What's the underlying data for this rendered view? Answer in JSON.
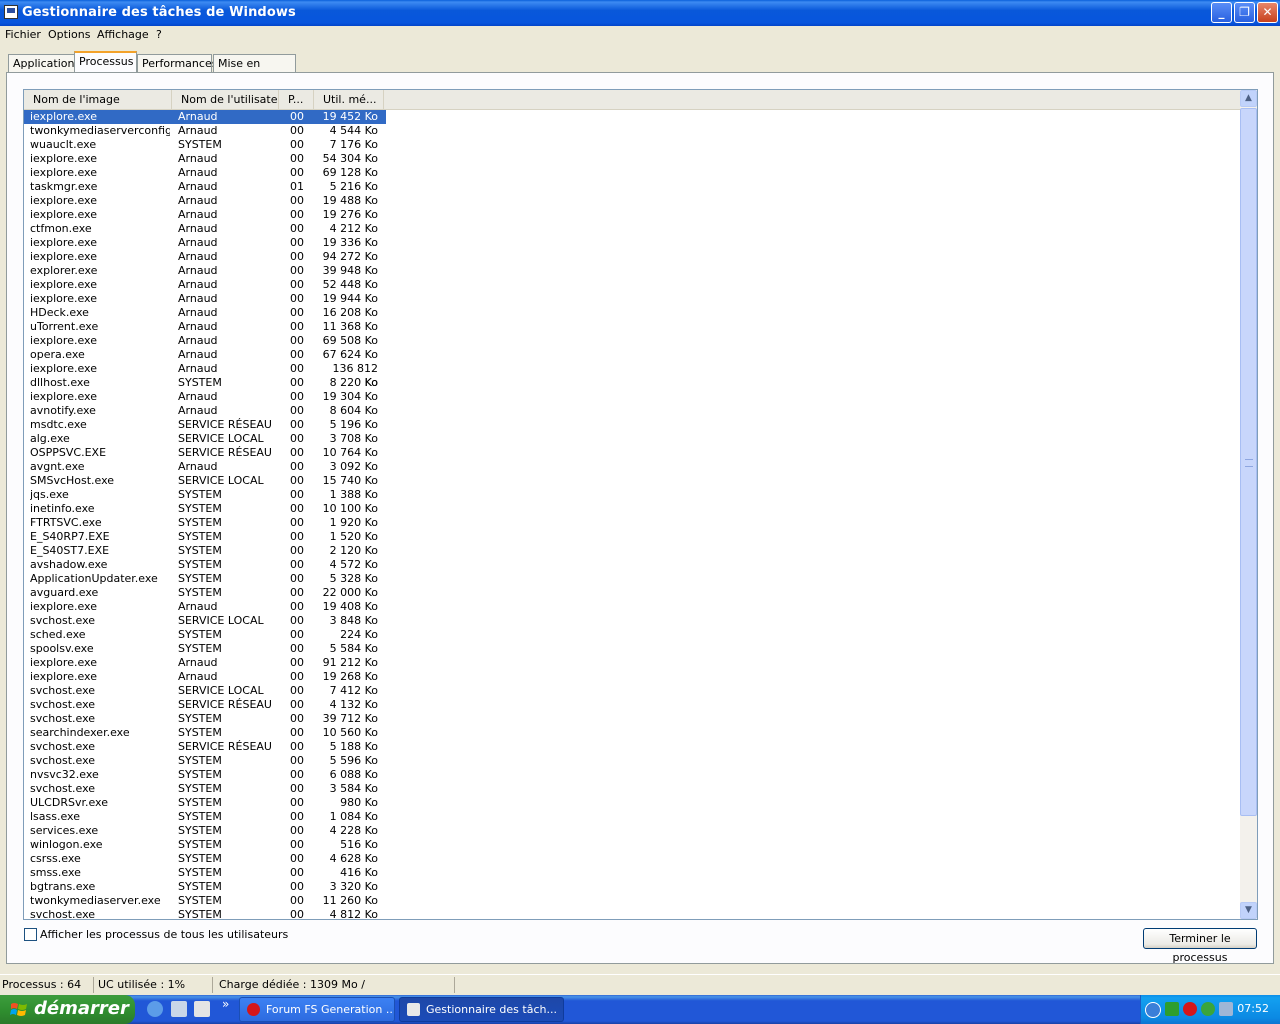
{
  "window": {
    "title": "Gestionnaire des tâches de Windows",
    "buttons": {
      "minimize": "_",
      "maximize": "❐",
      "close": "✕"
    }
  },
  "menu": [
    "Fichier",
    "Options",
    "Affichage",
    "?"
  ],
  "tabs": [
    "Applications",
    "Processus",
    "Performances",
    "Mise en réseau"
  ],
  "active_tab": "Processus",
  "columns": [
    "Nom de l'image",
    "Nom de l'utilisateur",
    "P...",
    "Util. mé..."
  ],
  "processes": [
    {
      "name": "iexplore.exe",
      "user": "Arnaud",
      "cpu": "00",
      "mem": "19 452 Ko",
      "selected": true
    },
    {
      "name": "twonkymediaserverconfig....",
      "user": "Arnaud",
      "cpu": "00",
      "mem": "4 544 Ko"
    },
    {
      "name": "wuauclt.exe",
      "user": "SYSTEM",
      "cpu": "00",
      "mem": "7 176 Ko"
    },
    {
      "name": "iexplore.exe",
      "user": "Arnaud",
      "cpu": "00",
      "mem": "54 304 Ko"
    },
    {
      "name": "iexplore.exe",
      "user": "Arnaud",
      "cpu": "00",
      "mem": "69 128 Ko"
    },
    {
      "name": "taskmgr.exe",
      "user": "Arnaud",
      "cpu": "01",
      "mem": "5 216 Ko"
    },
    {
      "name": "iexplore.exe",
      "user": "Arnaud",
      "cpu": "00",
      "mem": "19 488 Ko"
    },
    {
      "name": "iexplore.exe",
      "user": "Arnaud",
      "cpu": "00",
      "mem": "19 276 Ko"
    },
    {
      "name": "ctfmon.exe",
      "user": "Arnaud",
      "cpu": "00",
      "mem": "4 212 Ko"
    },
    {
      "name": "iexplore.exe",
      "user": "Arnaud",
      "cpu": "00",
      "mem": "19 336 Ko"
    },
    {
      "name": "iexplore.exe",
      "user": "Arnaud",
      "cpu": "00",
      "mem": "94 272 Ko"
    },
    {
      "name": "explorer.exe",
      "user": "Arnaud",
      "cpu": "00",
      "mem": "39 948 Ko"
    },
    {
      "name": "iexplore.exe",
      "user": "Arnaud",
      "cpu": "00",
      "mem": "52 448 Ko"
    },
    {
      "name": "iexplore.exe",
      "user": "Arnaud",
      "cpu": "00",
      "mem": "19 944 Ko"
    },
    {
      "name": "HDeck.exe",
      "user": "Arnaud",
      "cpu": "00",
      "mem": "16 208 Ko"
    },
    {
      "name": "uTorrent.exe",
      "user": "Arnaud",
      "cpu": "00",
      "mem": "11 368 Ko"
    },
    {
      "name": "iexplore.exe",
      "user": "Arnaud",
      "cpu": "00",
      "mem": "69 508 Ko"
    },
    {
      "name": "opera.exe",
      "user": "Arnaud",
      "cpu": "00",
      "mem": "67 624 Ko"
    },
    {
      "name": "iexplore.exe",
      "user": "Arnaud",
      "cpu": "00",
      "mem": "136 812 Ko"
    },
    {
      "name": "dllhost.exe",
      "user": "SYSTEM",
      "cpu": "00",
      "mem": "8 220 Ko"
    },
    {
      "name": "iexplore.exe",
      "user": "Arnaud",
      "cpu": "00",
      "mem": "19 304 Ko"
    },
    {
      "name": "avnotify.exe",
      "user": "Arnaud",
      "cpu": "00",
      "mem": "8 604 Ko"
    },
    {
      "name": "msdtc.exe",
      "user": "SERVICE RÉSEAU",
      "cpu": "00",
      "mem": "5 196 Ko"
    },
    {
      "name": "alg.exe",
      "user": "SERVICE LOCAL",
      "cpu": "00",
      "mem": "3 708 Ko"
    },
    {
      "name": "OSPPSVC.EXE",
      "user": "SERVICE RÉSEAU",
      "cpu": "00",
      "mem": "10 764 Ko"
    },
    {
      "name": "avgnt.exe",
      "user": "Arnaud",
      "cpu": "00",
      "mem": "3 092 Ko"
    },
    {
      "name": "SMSvcHost.exe",
      "user": "SERVICE LOCAL",
      "cpu": "00",
      "mem": "15 740 Ko"
    },
    {
      "name": "jqs.exe",
      "user": "SYSTEM",
      "cpu": "00",
      "mem": "1 388 Ko"
    },
    {
      "name": "inetinfo.exe",
      "user": "SYSTEM",
      "cpu": "00",
      "mem": "10 100 Ko"
    },
    {
      "name": "FTRTSVC.exe",
      "user": "SYSTEM",
      "cpu": "00",
      "mem": "1 920 Ko"
    },
    {
      "name": "E_S40RP7.EXE",
      "user": "SYSTEM",
      "cpu": "00",
      "mem": "1 520 Ko"
    },
    {
      "name": "E_S40ST7.EXE",
      "user": "SYSTEM",
      "cpu": "00",
      "mem": "2 120 Ko"
    },
    {
      "name": "avshadow.exe",
      "user": "SYSTEM",
      "cpu": "00",
      "mem": "4 572 Ko"
    },
    {
      "name": "ApplicationUpdater.exe",
      "user": "SYSTEM",
      "cpu": "00",
      "mem": "5 328 Ko"
    },
    {
      "name": "avguard.exe",
      "user": "SYSTEM",
      "cpu": "00",
      "mem": "22 000 Ko"
    },
    {
      "name": "iexplore.exe",
      "user": "Arnaud",
      "cpu": "00",
      "mem": "19 408 Ko"
    },
    {
      "name": "svchost.exe",
      "user": "SERVICE LOCAL",
      "cpu": "00",
      "mem": "3 848 Ko"
    },
    {
      "name": "sched.exe",
      "user": "SYSTEM",
      "cpu": "00",
      "mem": "224 Ko"
    },
    {
      "name": "spoolsv.exe",
      "user": "SYSTEM",
      "cpu": "00",
      "mem": "5 584 Ko"
    },
    {
      "name": "iexplore.exe",
      "user": "Arnaud",
      "cpu": "00",
      "mem": "91 212 Ko"
    },
    {
      "name": "iexplore.exe",
      "user": "Arnaud",
      "cpu": "00",
      "mem": "19 268 Ko"
    },
    {
      "name": "svchost.exe",
      "user": "SERVICE LOCAL",
      "cpu": "00",
      "mem": "7 412 Ko"
    },
    {
      "name": "svchost.exe",
      "user": "SERVICE RÉSEAU",
      "cpu": "00",
      "mem": "4 132 Ko"
    },
    {
      "name": "svchost.exe",
      "user": "SYSTEM",
      "cpu": "00",
      "mem": "39 712 Ko"
    },
    {
      "name": "searchindexer.exe",
      "user": "SYSTEM",
      "cpu": "00",
      "mem": "10 560 Ko"
    },
    {
      "name": "svchost.exe",
      "user": "SERVICE RÉSEAU",
      "cpu": "00",
      "mem": "5 188 Ko"
    },
    {
      "name": "svchost.exe",
      "user": "SYSTEM",
      "cpu": "00",
      "mem": "5 596 Ko"
    },
    {
      "name": "nvsvc32.exe",
      "user": "SYSTEM",
      "cpu": "00",
      "mem": "6 088 Ko"
    },
    {
      "name": "svchost.exe",
      "user": "SYSTEM",
      "cpu": "00",
      "mem": "3 584 Ko"
    },
    {
      "name": "ULCDRSvr.exe",
      "user": "SYSTEM",
      "cpu": "00",
      "mem": "980 Ko"
    },
    {
      "name": "lsass.exe",
      "user": "SYSTEM",
      "cpu": "00",
      "mem": "1 084 Ko"
    },
    {
      "name": "services.exe",
      "user": "SYSTEM",
      "cpu": "00",
      "mem": "4 228 Ko"
    },
    {
      "name": "winlogon.exe",
      "user": "SYSTEM",
      "cpu": "00",
      "mem": "516 Ko"
    },
    {
      "name": "csrss.exe",
      "user": "SYSTEM",
      "cpu": "00",
      "mem": "4 628 Ko"
    },
    {
      "name": "smss.exe",
      "user": "SYSTEM",
      "cpu": "00",
      "mem": "416 Ko"
    },
    {
      "name": "bgtrans.exe",
      "user": "SYSTEM",
      "cpu": "00",
      "mem": "3 320 Ko"
    },
    {
      "name": "twonkymediaserver.exe",
      "user": "SYSTEM",
      "cpu": "00",
      "mem": "11 260 Ko"
    },
    {
      "name": "svchost.exe",
      "user": "SYSTEM",
      "cpu": "00",
      "mem": "4 812 Ko"
    }
  ],
  "show_all_users_label": "Afficher les processus de tous les utilisateurs",
  "show_all_users_checked": false,
  "end_process_label": "Terminer le processus",
  "status": {
    "processes": "Processus : 64",
    "cpu": "UC utilisée : 1%",
    "commit": "Charge dédiée : 1309 Mo /"
  },
  "taskbar": {
    "start_label": "démarrer",
    "overflow": "»",
    "buttons": [
      {
        "label": "Forum FS Generation ...",
        "icon": "opera-icon",
        "active": false
      },
      {
        "label": "Gestionnaire des tâch...",
        "icon": "taskmgr-icon",
        "active": true
      }
    ],
    "clock": "07:52"
  },
  "colors": {
    "selection": "#316AC5",
    "titlebar": "#0A5FDB",
    "taskbar": "#2157D7",
    "start": "#3A9B3A"
  }
}
